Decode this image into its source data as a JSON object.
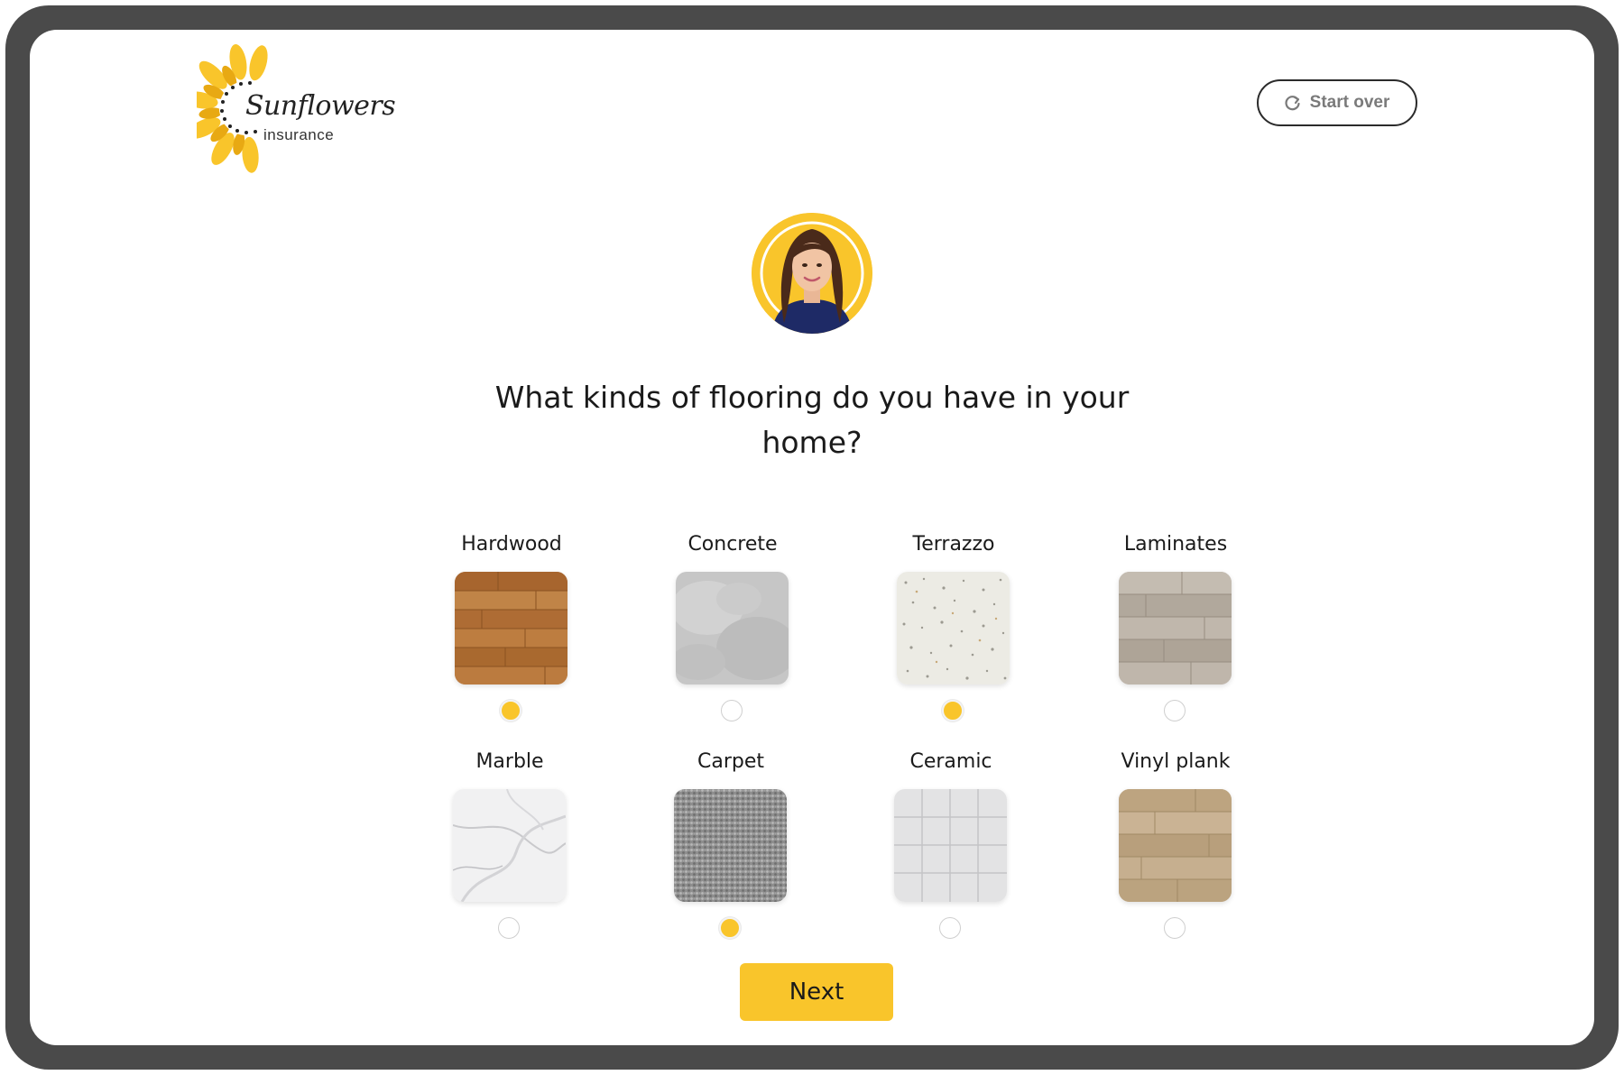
{
  "brand": {
    "name": "Sunflowers",
    "tagline": "insurance",
    "accent_color": "#f9c52b"
  },
  "header": {
    "start_over_label": "Start over",
    "start_over_icon": "refresh-icon"
  },
  "question": {
    "text": "What kinds of flooring do you have in your home?"
  },
  "options": [
    {
      "label": "Hardwood",
      "selected": true
    },
    {
      "label": "Concrete",
      "selected": false
    },
    {
      "label": "Terrazzo",
      "selected": true
    },
    {
      "label": "Laminates",
      "selected": false
    },
    {
      "label": "Marble",
      "selected": false
    },
    {
      "label": "Carpet",
      "selected": true
    },
    {
      "label": "Ceramic",
      "selected": false
    },
    {
      "label": "Vinyl plank",
      "selected": false
    }
  ],
  "footer": {
    "next_label": "Next"
  }
}
